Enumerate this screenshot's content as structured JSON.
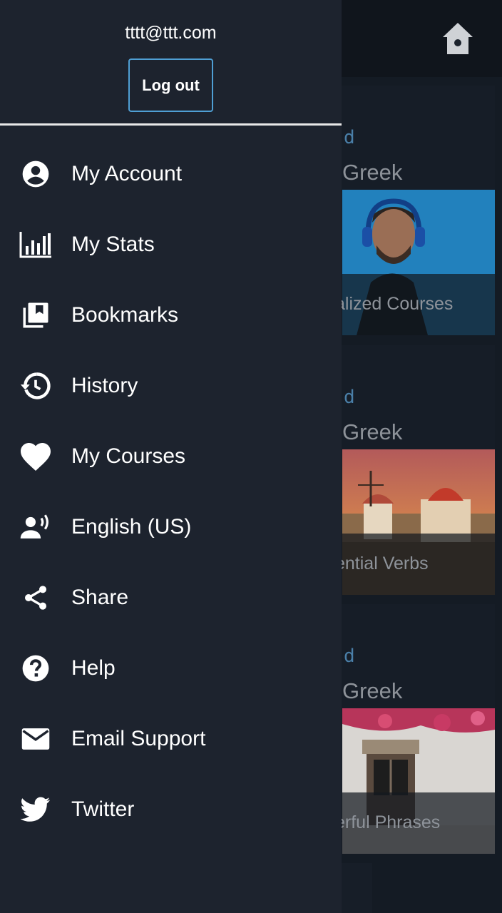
{
  "background": {
    "cards": [
      {
        "level": "d",
        "language": "Greek",
        "caption": "alized Courses",
        "thumb": "headphones-man"
      },
      {
        "level": "d",
        "language": "Greek",
        "caption": "ential Verbs",
        "thumb": "santorini"
      },
      {
        "level": "d",
        "language": "Greek",
        "caption": "erful Phrases",
        "thumb": "window-flowers"
      }
    ],
    "header_icon": "home-icon"
  },
  "drawer": {
    "user_email": "tttt@ttt.com",
    "logout_label": "Log out",
    "menu": [
      {
        "label": "My Account",
        "icon": "account-circle-icon"
      },
      {
        "label": "My Stats",
        "icon": "stats-bar-icon"
      },
      {
        "label": "Bookmarks",
        "icon": "bookmarks-icon"
      },
      {
        "label": "History",
        "icon": "history-icon"
      },
      {
        "label": "My Courses",
        "icon": "heart-icon"
      },
      {
        "label": "English (US)",
        "icon": "voice-language-icon"
      },
      {
        "label": "Share",
        "icon": "share-icon"
      },
      {
        "label": "Help",
        "icon": "help-icon"
      },
      {
        "label": "Email Support",
        "icon": "email-icon"
      },
      {
        "label": "Twitter",
        "icon": "twitter-icon"
      }
    ]
  },
  "colors": {
    "drawer_bg": "#1d232e",
    "accent_border": "#4f9fd4",
    "text": "#ffffff"
  }
}
